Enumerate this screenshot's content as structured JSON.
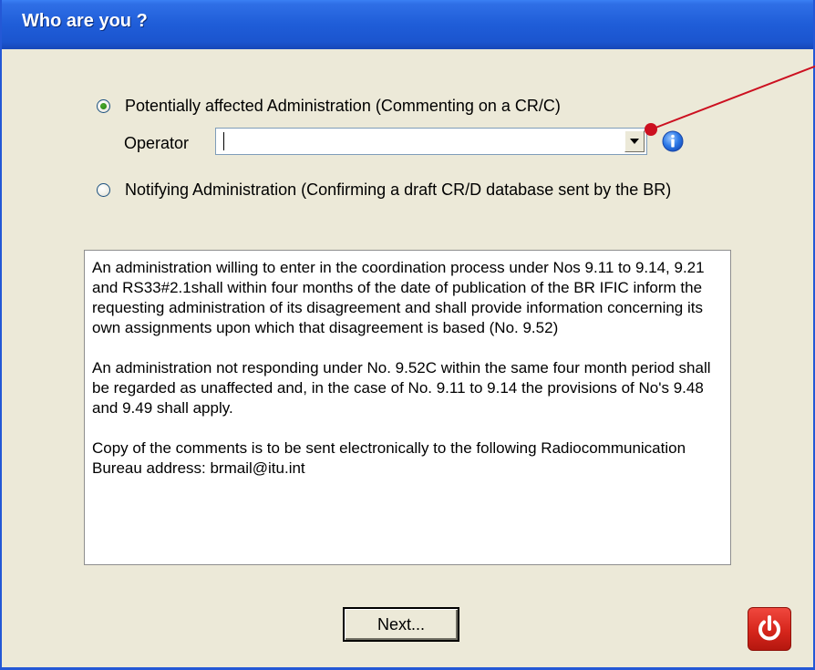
{
  "window": {
    "title": "Who are you ?"
  },
  "options": {
    "affected_label": "Potentially affected Administration (Commenting on a CR/C)",
    "affected_checked": true,
    "notifying_label": "Notifying Administration (Confirming a draft CR/D database sent by the BR)",
    "notifying_checked": false
  },
  "operator": {
    "label": "Operator",
    "value": ""
  },
  "info_text": {
    "paragraph1": "An administration willing to enter in the coordination process under Nos 9.11 to 9.14, 9.21 and RS33#2.1shall within four months of the date of publication of the BR IFIC inform the requesting administration of its disagreement and shall provide information concerning its own assignments upon which that disagreement is based (No. 9.52)",
    "paragraph2": "An administration not responding under No. 9.52C within the same four month period shall be regarded as unaffected and, in the case of No. 9.11 to 9.14 the provisions of No's 9.48 and 9.49 shall apply.",
    "paragraph3": "Copy of the comments is to be sent electronically to the following Radiocommunication Bureau address: brmail@itu.int"
  },
  "buttons": {
    "next_label": "Next..."
  },
  "icons": {
    "info": "info-icon",
    "power": "power-icon",
    "dropdown": "chevron-down-icon"
  },
  "colors": {
    "titlebar": "#1F5DD8",
    "annotation_line": "#CC1020",
    "power_button": "#D6261C"
  }
}
